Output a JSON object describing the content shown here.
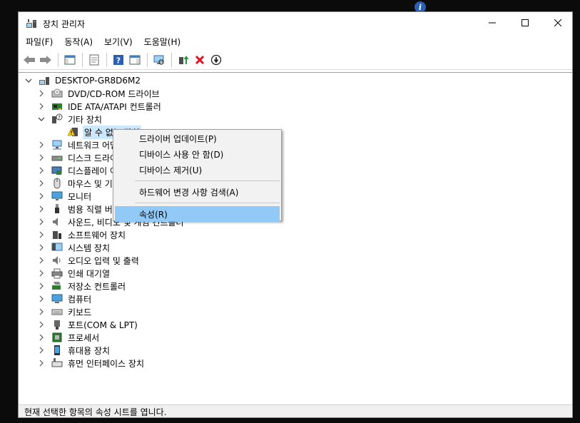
{
  "window": {
    "title": "장치 관리자"
  },
  "menu": [
    "파일(F)",
    "동작(A)",
    "보기(V)",
    "도움말(H)"
  ],
  "toolbar": [
    "back-icon",
    "forward-icon",
    "console-tree-icon",
    "properties-icon",
    "help-icon",
    "action-pane-icon",
    "scan-hardware-icon",
    "update-driver-icon",
    "uninstall-icon",
    "disable-icon"
  ],
  "tree": {
    "root": "DESKTOP-GR8D6M2",
    "categories": [
      {
        "label": "DVD/CD-ROM 드라이브",
        "icon": "dvd-drive-icon"
      },
      {
        "label": "IDE ATA/ATAPI 컨트롤러",
        "icon": "ide-controller-icon"
      },
      {
        "label": "기타 장치",
        "icon": "other-devices-icon",
        "expanded": true
      },
      {
        "label": "알 수 없는 장치",
        "icon": "unknown-device-warning-icon",
        "child": true,
        "selected": true
      },
      {
        "label": "네트워크 어댑터",
        "icon": "network-adapter-icon"
      },
      {
        "label": "디스크 드라이브",
        "icon": "disk-drive-icon"
      },
      {
        "label": "디스플레이 어댑터",
        "icon": "display-adapter-icon"
      },
      {
        "label": "마우스 및 기타 포인팅 장치",
        "icon": "mouse-icon"
      },
      {
        "label": "모니터",
        "icon": "monitor-icon"
      },
      {
        "label": "범용 직렬 버스 컨트롤러",
        "icon": "usb-icon"
      },
      {
        "label": "사운드, 비디오 및 게임 컨트롤러",
        "icon": "sound-icon"
      },
      {
        "label": "소프트웨어 장치",
        "icon": "software-device-icon"
      },
      {
        "label": "시스템 장치",
        "icon": "system-device-icon"
      },
      {
        "label": "오디오 입력 및 출력",
        "icon": "audio-io-icon"
      },
      {
        "label": "인쇄 대기열",
        "icon": "print-queue-icon"
      },
      {
        "label": "저장소 컨트롤러",
        "icon": "storage-controller-icon"
      },
      {
        "label": "컴퓨터",
        "icon": "computer-icon"
      },
      {
        "label": "키보드",
        "icon": "keyboard-icon"
      },
      {
        "label": "포트(COM & LPT)",
        "icon": "port-icon"
      },
      {
        "label": "프로세서",
        "icon": "processor-icon"
      },
      {
        "label": "휴대용 장치",
        "icon": "portable-device-icon"
      },
      {
        "label": "휴먼 인터페이스 장치",
        "icon": "hid-icon"
      }
    ]
  },
  "context_menu": {
    "items": [
      {
        "label": "드라이버 업데이트(P)"
      },
      {
        "label": "디바이스 사용 안 함(D)"
      },
      {
        "label": "디바이스 제거(U)"
      },
      {
        "separator": true
      },
      {
        "label": "하드웨어 변경 사항 검색(A)"
      },
      {
        "separator": true
      },
      {
        "label": "속성(R)",
        "highlighted": true
      }
    ]
  },
  "status": {
    "text": "현재 선택한 항목의 속성 시트를 엽니다."
  },
  "colors": {
    "highlight": "#91c9f7",
    "selection": "#cce8ff",
    "uninstall": "#e81123"
  }
}
